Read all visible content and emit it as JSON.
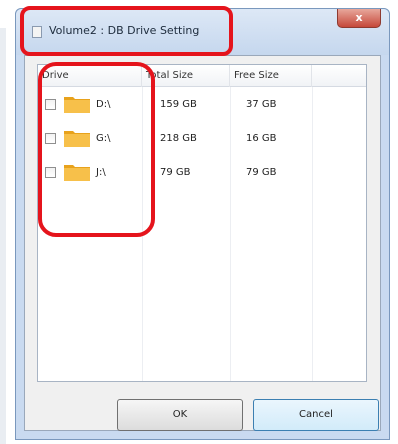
{
  "window": {
    "title": "Volume2 : DB Drive Setting",
    "close_glyph": "x"
  },
  "listview": {
    "columns": [
      "Drive",
      "Total Size",
      "Free Size",
      ""
    ],
    "rows": [
      {
        "drive": "D:\\",
        "total": "159 GB",
        "free": "37 GB",
        "checked": false
      },
      {
        "drive": "G:\\",
        "total": "218 GB",
        "free": "16 GB",
        "checked": false
      },
      {
        "drive": "J:\\",
        "total": "79 GB",
        "free": "79 GB",
        "checked": false
      }
    ]
  },
  "buttons": {
    "ok": "OK",
    "cancel": "Cancel"
  },
  "colors": {
    "highlight": "#e5141c",
    "folder": "#f5b82e"
  }
}
